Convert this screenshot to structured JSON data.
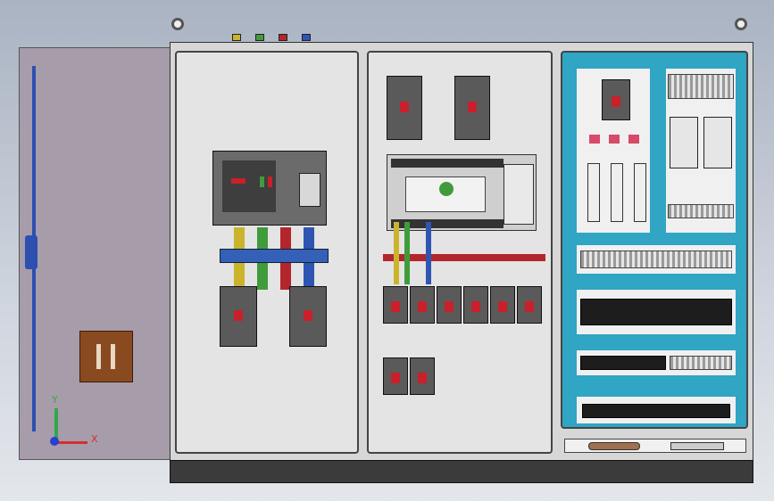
{
  "axes": {
    "y_label": "Y",
    "x_label": "X"
  },
  "colors": {
    "yellow": "#c9b42c",
    "green": "#3f9b3c",
    "red": "#b3262c",
    "blue": "#2f55b4",
    "busbar_blue": "#3560b8",
    "cyan_panel": "#30a5c4"
  }
}
